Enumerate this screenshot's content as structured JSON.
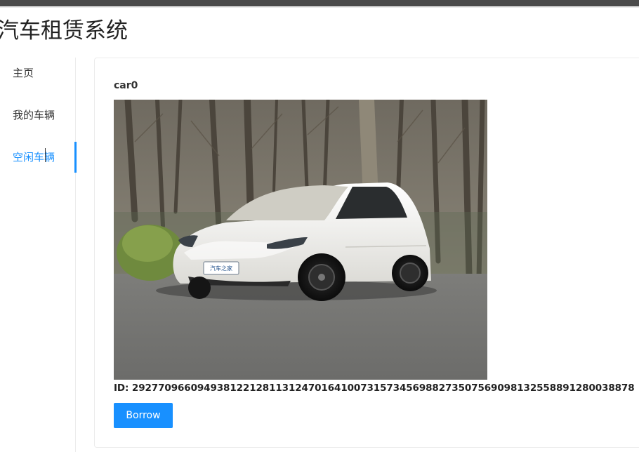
{
  "app": {
    "title": "汽车租赁系统"
  },
  "sidebar": {
    "items": [
      {
        "label": "主页",
        "active": false
      },
      {
        "label": "我的车辆",
        "active": false
      },
      {
        "label": "空闲车辆",
        "active": true
      }
    ]
  },
  "car": {
    "name": "car0",
    "plate_text": "汽车之家",
    "id_text": "ID: 29277096609493812212811312470164100731573456988273507569098132558891280038878"
  },
  "actions": {
    "borrow_label": "Borrow"
  },
  "colors": {
    "accent": "#1890ff",
    "car_body": "#f2f1ec"
  }
}
